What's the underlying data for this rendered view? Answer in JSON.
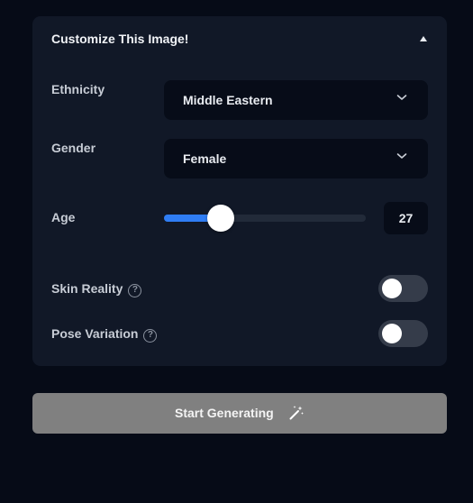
{
  "panel": {
    "title": "Customize This Image!",
    "expanded": true
  },
  "ethnicity": {
    "label": "Ethnicity",
    "value": "Middle Eastern"
  },
  "gender": {
    "label": "Gender",
    "value": "Female"
  },
  "age": {
    "label": "Age",
    "value": "27",
    "slider_fraction": 0.28,
    "accent_color": "#2f7df4"
  },
  "skin_reality": {
    "label": "Skin Reality",
    "help_icon": "?",
    "enabled": false
  },
  "pose_variation": {
    "label": "Pose Variation",
    "help_icon": "?",
    "enabled": false
  },
  "start_button": {
    "label": "Start Generating",
    "icon": "magic-wand-icon"
  }
}
